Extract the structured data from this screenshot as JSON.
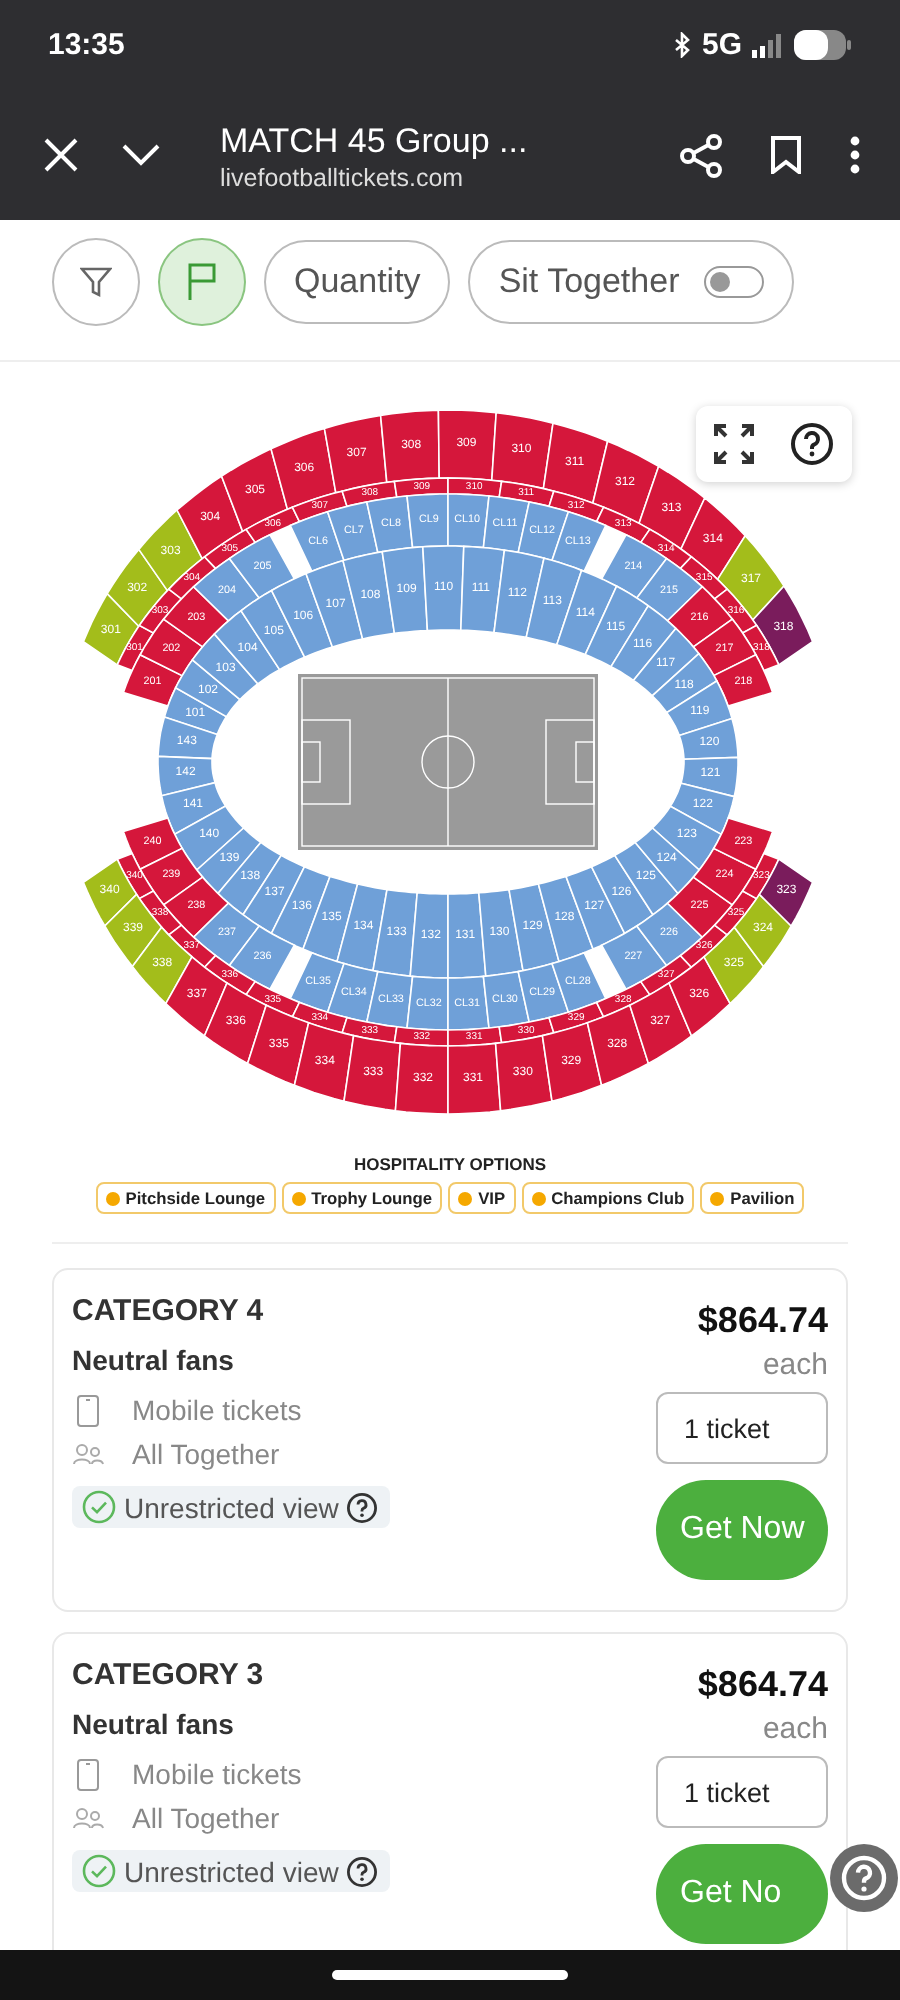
{
  "status_bar": {
    "time": "13:35",
    "network": "5G"
  },
  "browser_bar": {
    "title": "MATCH 45 Group ...",
    "url": "livefootballtickets.com"
  },
  "filters": [
    {
      "kind": "filter",
      "active": false
    },
    {
      "kind": "flag",
      "active": true
    },
    {
      "kind": "text",
      "label": "Quantity"
    },
    {
      "kind": "toggle",
      "label": "Sit Together",
      "on": false
    }
  ],
  "seat_map": {
    "blocks": [
      {
        "sections": [
          {
            "label": "301",
            "color": "#a3bd1b"
          },
          {
            "label": "302",
            "color": "#a3bd1b"
          },
          {
            "label": "303",
            "color": "#a3bd1b"
          },
          {
            "label": "304",
            "color": "#d5173b"
          },
          {
            "label": "305",
            "color": "#d5173b"
          },
          {
            "label": "306",
            "color": "#d5173b"
          },
          {
            "label": "307",
            "color": "#d5173b"
          },
          {
            "label": "308",
            "color": "#d5173b"
          },
          {
            "label": "309",
            "color": "#d5173b"
          },
          {
            "label": "310",
            "color": "#d5173b"
          },
          {
            "label": "311",
            "color": "#d5173b"
          },
          {
            "label": "312",
            "color": "#d5173b"
          },
          {
            "label": "313",
            "color": "#d5173b"
          },
          {
            "label": "314",
            "color": "#d5173b"
          }
        ]
      },
      {
        "sections": [
          {
            "label": "317",
            "color": "#a3bd1b"
          },
          {
            "label": "318",
            "color": "#7a1c5c"
          }
        ]
      },
      {
        "sections": [
          {
            "label": "301",
            "color": "#d5173b"
          },
          {
            "label": "303",
            "color": "#d5173b"
          },
          {
            "label": "304",
            "color": "#d5173b"
          },
          {
            "label": "305",
            "color": "#d5173b"
          },
          {
            "label": "306",
            "color": "#d5173b"
          },
          {
            "label": "307",
            "color": "#d5173b"
          },
          {
            "label": "308",
            "color": "#d5173b"
          },
          {
            "label": "309",
            "color": "#d5173b"
          },
          {
            "label": "310",
            "color": "#d5173b"
          },
          {
            "label": "311",
            "color": "#d5173b"
          },
          {
            "label": "312",
            "color": "#d5173b"
          },
          {
            "label": "313",
            "color": "#d5173b"
          },
          {
            "label": "314",
            "color": "#d5173b"
          },
          {
            "label": "315",
            "color": "#d5173b"
          },
          {
            "label": "316",
            "color": "#d5173b"
          },
          {
            "label": "318",
            "color": "#d5173b"
          }
        ]
      },
      {
        "sections": [
          {
            "label": "201",
            "color": "#d5173b"
          },
          {
            "label": "202",
            "color": "#d5173b"
          },
          {
            "label": "203",
            "color": "#d5173b"
          },
          {
            "label": "204",
            "color": "#6fa0d8"
          },
          {
            "label": "205",
            "color": "#6fa0d8"
          }
        ]
      },
      {
        "sections": [
          {
            "label": "CL6",
            "color": "#6fa0d8"
          },
          {
            "label": "CL7",
            "color": "#6fa0d8"
          },
          {
            "label": "CL8",
            "color": "#6fa0d8"
          },
          {
            "label": "CL9",
            "color": "#6fa0d8"
          },
          {
            "label": "CL10",
            "color": "#6fa0d8"
          },
          {
            "label": "CL11",
            "color": "#6fa0d8"
          },
          {
            "label": "CL12",
            "color": "#6fa0d8"
          },
          {
            "label": "CL13",
            "color": "#6fa0d8"
          }
        ]
      },
      {
        "sections": [
          {
            "label": "214",
            "color": "#6fa0d8"
          },
          {
            "label": "215",
            "color": "#6fa0d8"
          },
          {
            "label": "216",
            "color": "#d5173b"
          },
          {
            "label": "217",
            "color": "#d5173b"
          },
          {
            "label": "218",
            "color": "#d5173b"
          }
        ]
      },
      {
        "sections": [
          {
            "label": "101",
            "color": "#6fa0d8"
          },
          {
            "label": "102",
            "color": "#6fa0d8"
          },
          {
            "label": "103",
            "color": "#6fa0d8"
          },
          {
            "label": "104",
            "color": "#6fa0d8"
          },
          {
            "label": "105",
            "color": "#6fa0d8"
          },
          {
            "label": "106",
            "color": "#6fa0d8"
          },
          {
            "label": "107",
            "color": "#6fa0d8"
          },
          {
            "label": "108",
            "color": "#6fa0d8"
          },
          {
            "label": "109",
            "color": "#6fa0d8"
          },
          {
            "label": "110",
            "color": "#6fa0d8"
          },
          {
            "label": "111",
            "color": "#6fa0d8"
          },
          {
            "label": "112",
            "color": "#6fa0d8"
          },
          {
            "label": "113",
            "color": "#6fa0d8"
          },
          {
            "label": "114",
            "color": "#6fa0d8"
          },
          {
            "label": "115",
            "color": "#6fa0d8"
          },
          {
            "label": "116",
            "color": "#6fa0d8"
          },
          {
            "label": "117",
            "color": "#6fa0d8"
          },
          {
            "label": "118",
            "color": "#6fa0d8"
          }
        ]
      },
      {
        "sections": [
          {
            "label": "143",
            "color": "#6fa0d8"
          },
          {
            "label": "142",
            "color": "#6fa0d8"
          },
          {
            "label": "141",
            "color": "#6fa0d8"
          },
          {
            "label": "140",
            "color": "#6fa0d8"
          }
        ]
      },
      {
        "sections": [
          {
            "label": "119",
            "color": "#6fa0d8"
          },
          {
            "label": "120",
            "color": "#6fa0d8"
          },
          {
            "label": "121",
            "color": "#6fa0d8"
          },
          {
            "label": "122",
            "color": "#6fa0d8"
          },
          {
            "label": "123",
            "color": "#6fa0d8"
          }
        ]
      },
      {
        "sections": [
          {
            "label": "139",
            "color": "#6fa0d8"
          },
          {
            "label": "138",
            "color": "#6fa0d8"
          },
          {
            "label": "137",
            "color": "#6fa0d8"
          },
          {
            "label": "136",
            "color": "#6fa0d8"
          },
          {
            "label": "135",
            "color": "#6fa0d8"
          },
          {
            "label": "134",
            "color": "#6fa0d8"
          },
          {
            "label": "133",
            "color": "#6fa0d8"
          },
          {
            "label": "132",
            "color": "#6fa0d8"
          },
          {
            "label": "131",
            "color": "#6fa0d8"
          },
          {
            "label": "130",
            "color": "#6fa0d8"
          },
          {
            "label": "129",
            "color": "#6fa0d8"
          },
          {
            "label": "128",
            "color": "#6fa0d8"
          },
          {
            "label": "127",
            "color": "#6fa0d8"
          },
          {
            "label": "126",
            "color": "#6fa0d8"
          },
          {
            "label": "125",
            "color": "#6fa0d8"
          },
          {
            "label": "124",
            "color": "#6fa0d8"
          }
        ]
      },
      {
        "sections": [
          {
            "label": "240",
            "color": "#d5173b"
          },
          {
            "label": "239",
            "color": "#d5173b"
          },
          {
            "label": "238",
            "color": "#d5173b"
          },
          {
            "label": "237",
            "color": "#6fa0d8"
          },
          {
            "label": "236",
            "color": "#6fa0d8"
          }
        ]
      },
      {
        "sections": [
          {
            "label": "CL35",
            "color": "#6fa0d8"
          },
          {
            "label": "CL34",
            "color": "#6fa0d8"
          },
          {
            "label": "CL33",
            "color": "#6fa0d8"
          },
          {
            "label": "CL32",
            "color": "#6fa0d8"
          },
          {
            "label": "CL31",
            "color": "#6fa0d8"
          },
          {
            "label": "CL30",
            "color": "#6fa0d8"
          },
          {
            "label": "CL29",
            "color": "#6fa0d8"
          },
          {
            "label": "CL28",
            "color": "#6fa0d8"
          }
        ]
      },
      {
        "sections": [
          {
            "label": "227",
            "color": "#6fa0d8"
          },
          {
            "label": "226",
            "color": "#6fa0d8"
          },
          {
            "label": "225",
            "color": "#d5173b"
          },
          {
            "label": "224",
            "color": "#d5173b"
          },
          {
            "label": "223",
            "color": "#d5173b"
          }
        ]
      },
      {
        "sections": [
          {
            "label": "340",
            "color": "#d5173b"
          },
          {
            "label": "338",
            "color": "#d5173b"
          },
          {
            "label": "337",
            "color": "#d5173b"
          },
          {
            "label": "336",
            "color": "#d5173b"
          },
          {
            "label": "335",
            "color": "#d5173b"
          },
          {
            "label": "334",
            "color": "#d5173b"
          },
          {
            "label": "333",
            "color": "#d5173b"
          },
          {
            "label": "332",
            "color": "#d5173b"
          },
          {
            "label": "331",
            "color": "#d5173b"
          },
          {
            "label": "330",
            "color": "#d5173b"
          },
          {
            "label": "329",
            "color": "#d5173b"
          },
          {
            "label": "328",
            "color": "#d5173b"
          },
          {
            "label": "327",
            "color": "#d5173b"
          },
          {
            "label": "326",
            "color": "#d5173b"
          },
          {
            "label": "325",
            "color": "#d5173b"
          },
          {
            "label": "323",
            "color": "#d5173b"
          }
        ]
      },
      {
        "sections": [
          {
            "label": "340",
            "color": "#a3bd1b"
          },
          {
            "label": "339",
            "color": "#a3bd1b"
          },
          {
            "label": "338",
            "color": "#a3bd1b"
          },
          {
            "label": "337",
            "color": "#d5173b"
          },
          {
            "label": "336",
            "color": "#d5173b"
          },
          {
            "label": "335",
            "color": "#d5173b"
          },
          {
            "label": "334",
            "color": "#d5173b"
          },
          {
            "label": "333",
            "color": "#d5173b"
          },
          {
            "label": "332",
            "color": "#d5173b"
          },
          {
            "label": "331",
            "color": "#d5173b"
          },
          {
            "label": "330",
            "color": "#d5173b"
          },
          {
            "label": "329",
            "color": "#d5173b"
          },
          {
            "label": "328",
            "color": "#d5173b"
          },
          {
            "label": "327",
            "color": "#d5173b"
          },
          {
            "label": "326",
            "color": "#d5173b"
          },
          {
            "label": "325",
            "color": "#a3bd1b"
          },
          {
            "label": "324",
            "color": "#a3bd1b"
          },
          {
            "label": "323",
            "color": "#7a1c5c"
          }
        ]
      }
    ]
  },
  "hospitality": {
    "title": "HOSPITALITY OPTIONS",
    "options": [
      "Pitchside Lounge",
      "Trophy Lounge",
      "VIP",
      "Champions Club",
      "Pavilion"
    ]
  },
  "tickets": [
    {
      "category": "CATEGORY 4",
      "fans": "Neutral fans",
      "features": [
        {
          "kind": "mobile",
          "text": "Mobile tickets"
        },
        {
          "kind": "group",
          "text": "All Together"
        }
      ],
      "badge": "Unrestricted view",
      "price": "$864.74",
      "per": "each",
      "quantity": "1 ticket",
      "action": "Get Now"
    },
    {
      "category": "CATEGORY 3",
      "fans": "Neutral fans",
      "features": [
        {
          "kind": "mobile",
          "text": "Mobile tickets"
        },
        {
          "kind": "group",
          "text": "All Together"
        }
      ],
      "badge": "Unrestricted view",
      "price": "$864.74",
      "per": "each",
      "quantity": "1 ticket",
      "action": "Get No"
    }
  ]
}
